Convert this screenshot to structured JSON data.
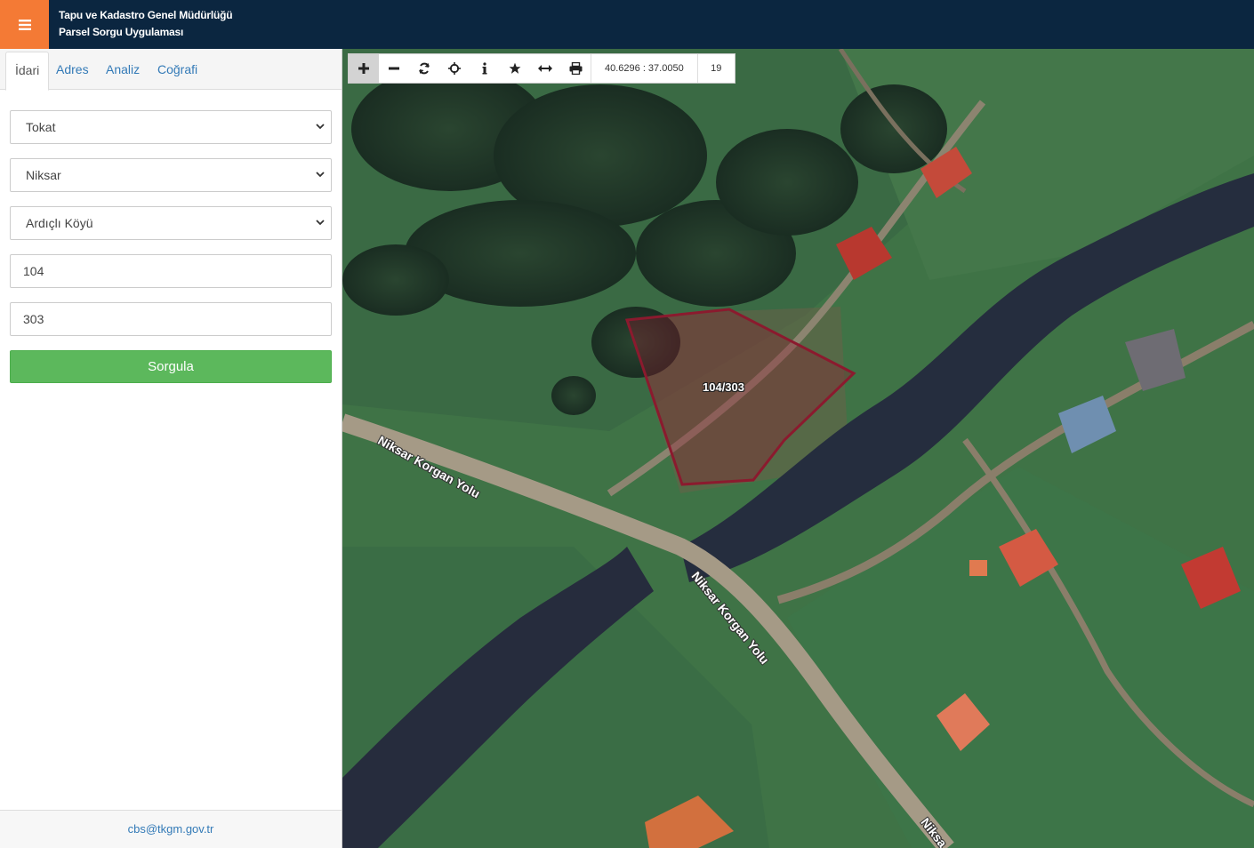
{
  "header": {
    "org_name": "Tapu ve Kadastro Genel Müdürlüğü",
    "app_name": "Parsel Sorgu Uygulaması"
  },
  "tabs": [
    {
      "label": "İdari",
      "active": true
    },
    {
      "label": "Adres",
      "active": false
    },
    {
      "label": "Analiz",
      "active": false
    },
    {
      "label": "Coğrafi",
      "active": false
    }
  ],
  "form": {
    "province": "Tokat",
    "district": "Niksar",
    "neighborhood": "Ardıçlı Köyü",
    "block_no": "104",
    "parcel_no": "303",
    "submit_label": "Sorgula"
  },
  "footer": {
    "email": "cbs@tkgm.gov.tr"
  },
  "map": {
    "coordinates": "40.6296 : 37.0050",
    "zoom_level": "19",
    "parcel_label": "104/303",
    "road_label_1": "Niksar Korgan Yolu",
    "road_label_2": "Niksar Korgan Yolu",
    "road_label_3": "Niksa",
    "toolbar_icons": [
      "plus-icon",
      "minus-icon",
      "refresh-icon",
      "crosshair-icon",
      "info-icon",
      "star-icon",
      "measure-icon",
      "print-icon"
    ]
  },
  "colors": {
    "header_bg": "#0b2640",
    "menu_accent": "#f47a35",
    "submit_green": "#5cb85c",
    "link_blue": "#337ab7",
    "parcel_outline": "#8b1a2e"
  }
}
